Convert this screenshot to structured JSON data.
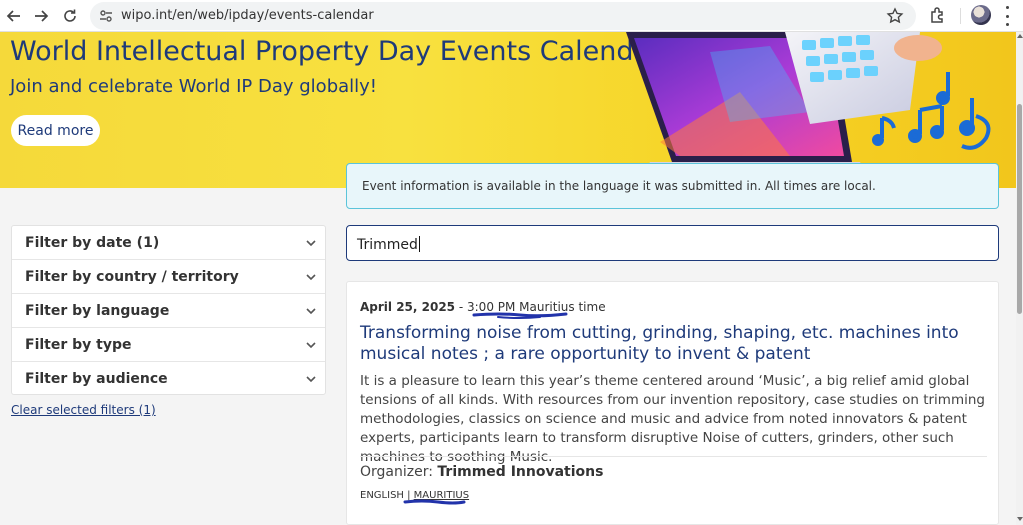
{
  "browser": {
    "url": "wipo.int/en/web/ipday/events-calendar",
    "icons": [
      "back-arrow-icon",
      "forward-arrow-icon",
      "reload-icon",
      "site-settings-icon",
      "bookmark-star-icon",
      "extensions-icon",
      "menu-icon"
    ]
  },
  "hero": {
    "title": "World Intellectual Property Day Events Calendar",
    "subtitle": "Join and celebrate World IP Day globally!",
    "button_label": "Read more"
  },
  "notice": {
    "text": "Event information is available in the language it was submitted in. All times are local."
  },
  "filters": {
    "items": [
      {
        "label": "Filter by date (1)"
      },
      {
        "label": "Filter by country / territory"
      },
      {
        "label": "Filter by language"
      },
      {
        "label": "Filter by type"
      },
      {
        "label": "Filter by audience"
      }
    ],
    "clear_label": "Clear selected filters (1)"
  },
  "search": {
    "value": "Trimmed"
  },
  "event": {
    "date": "April 25, 2025",
    "time": " - 3:00 PM Mauritius time",
    "title": "Transforming noise from cutting, grinding, shaping, etc. machines into musical notes ; a rare opportunity to invent & patent",
    "description": "It is a pleasure to learn this year’s theme centered around ‘Music’, a big relief amid global tensions of all kinds. With resources from our invention repository, case studies on trimming methodologies, classics on science and music and advice from noted innovators & patent experts, participants learn to transform disruptive Noise of cutters, grinders, other such machines to soothing Music.",
    "organizer_label": "Organizer: ",
    "organizer_name": "Trimmed Innovations",
    "language": "ENGLISH",
    "separator": " | ",
    "country": "MAURITIUS"
  },
  "colors": {
    "brand_blue": "#1e3a7a",
    "hero_yellow": "#f8e13f",
    "notice_border": "#5bc4da",
    "annotation_ink": "#2233aa"
  }
}
